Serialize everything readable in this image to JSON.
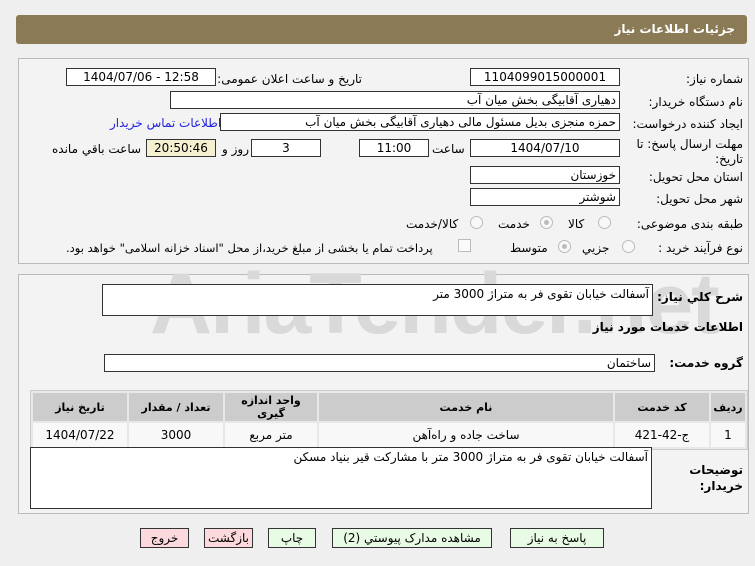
{
  "header": {
    "title": "جزئیات اطلاعات نیاز"
  },
  "watermark": "AriaTender.net",
  "form": {
    "need_number_label": "شماره نیاز:",
    "need_number": "1104099015000001",
    "announce_label": "تاریخ و ساعت اعلان عمومی:",
    "announce_value": "1404/07/06 - 12:58",
    "buyer_label": "نام دستگاه خریدار:",
    "buyer": "دهیاری آقابیگی بخش میان آب",
    "creator_label": "ایجاد کننده درخواست:",
    "creator": "حمزه منجزی بدیل مسئول مالی دهیاری آقابیگی بخش میان آب",
    "contact_link": "اطلاعات تماس خریدار",
    "deadline_label": "مهلت ارسال پاسخ: تا تاریخ:",
    "deadline_date": "1404/07/10",
    "time_label": "ساعت",
    "deadline_time": "11:00",
    "days": "3",
    "days_label": "روز و",
    "remaining": "20:50:46",
    "remaining_label": "ساعت باقي مانده",
    "province_label": "استان محل تحویل:",
    "province": "خوزستان",
    "city_label": "شهر محل تحویل:",
    "city": "شوشتر",
    "category_label": "طبقه بندی موضوعی:",
    "category_options": [
      "کالا",
      "خدمت",
      "کالا/خدمت"
    ],
    "category_selected": "خدمت",
    "process_label": "نوع فرآیند خرید :",
    "process_options": [
      "جزیي",
      "متوسط"
    ],
    "process_selected": "متوسط",
    "payment_note": "پرداخت تمام یا بخشی از مبلغ خرید،از محل \"اسناد خزانه اسلامی\" خواهد بود."
  },
  "details": {
    "summary_label": "شرح کلي نیاز:",
    "summary": "آسفالت خیابان تقوی فر به متراژ 3000 متر",
    "services_title": "اطلاعات خدمات مورد نیاز",
    "group_label": "گروه خدمت:",
    "group": "ساختمان",
    "table": {
      "headers": [
        "ردیف",
        "کد خدمت",
        "نام خدمت",
        "واحد اندازه گیری",
        "تعداد / مقدار",
        "تاریخ نیاز"
      ],
      "rows": [
        [
          "1",
          "ج-42-421",
          "ساخت جاده و راه‌آهن",
          "متر مربع",
          "3000",
          "1404/07/22"
        ]
      ]
    },
    "buyer_notes_label": "توضیحات خریدار:",
    "buyer_notes": "آسفالت خیابان تقوی فر به متراژ 3000 متر با مشارکت قیر بنیاد مسکن"
  },
  "buttons": {
    "reply": "پاسخ به نیاز",
    "docs": "مشاهده مدارک پیوستي (2)",
    "print": "چاپ",
    "back": "بازگشت",
    "exit": "خروج"
  }
}
